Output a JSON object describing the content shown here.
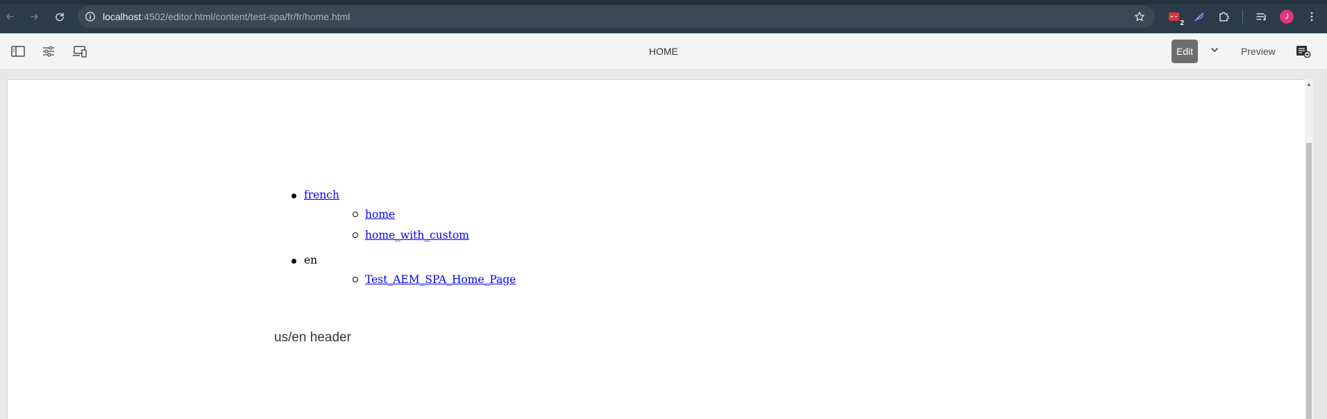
{
  "browser": {
    "url_host": "localhost",
    "url_path": ":4502/editor.html/content/test-spa/fr/fr/home.html",
    "extension_badge": "2",
    "avatar_initial": "J"
  },
  "editor": {
    "page_title": "HOME",
    "edit_label": "Edit",
    "preview_label": "Preview"
  },
  "content": {
    "nav": [
      {
        "label": "french",
        "is_link": true,
        "children": [
          "home",
          "home_with_custom"
        ]
      },
      {
        "label": "en",
        "is_link": false,
        "children": [
          "Test_AEM_SPA_Home_Page"
        ]
      }
    ],
    "header_text": "us/en header"
  },
  "colors": {
    "chrome_bg": "#2b3b49",
    "omnibox_bg": "#3a4955",
    "toolbar_bg": "#f4f4f4",
    "edit_button_bg": "#6e6e6e",
    "link": "#0000ee",
    "avatar_bg": "#e2357c"
  },
  "icons": {
    "back": "back-arrow-icon",
    "forward": "forward-arrow-icon",
    "reload": "reload-icon",
    "site_info": "site-info-icon",
    "bookmark": "star-icon",
    "side_panel": "side-panel-icon",
    "page_properties": "sliders-icon",
    "emulator": "devices-icon",
    "annotations": "emulator-settings-icon"
  }
}
